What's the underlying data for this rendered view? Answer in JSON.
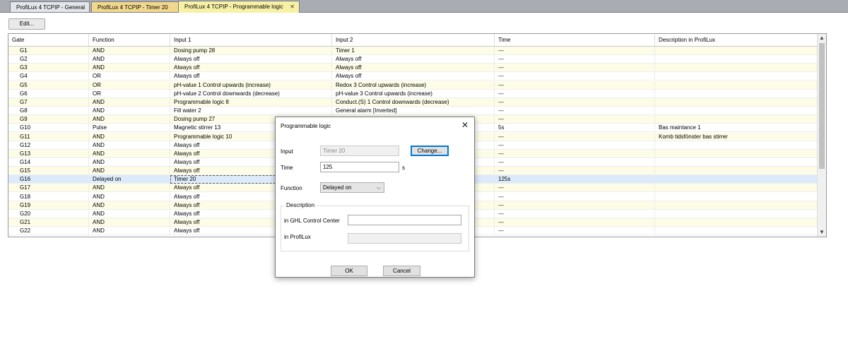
{
  "tabs": [
    {
      "label": "ProfiLux 4 TCPIP - General"
    },
    {
      "label": "ProfiLux 4 TCPIP - Timer 20"
    },
    {
      "label": "ProfiLux 4 TCPIP - Programmable logic",
      "close": "✕"
    }
  ],
  "toolbar": {
    "edit_label": "Edit..."
  },
  "grid": {
    "columns": [
      "Gate",
      "Function",
      "Input 1",
      "Input 2",
      "Time",
      "Description in ProfiLux"
    ],
    "rows": [
      {
        "gate": "G1",
        "function": "AND",
        "input1": "Dosing pump 28",
        "input2": "Timer 1",
        "time": "---",
        "desc": ""
      },
      {
        "gate": "G2",
        "function": "AND",
        "input1": "Always off",
        "input2": "Always off",
        "time": "---",
        "desc": ""
      },
      {
        "gate": "G3",
        "function": "AND",
        "input1": "Always off",
        "input2": "Always off",
        "time": "---",
        "desc": ""
      },
      {
        "gate": "G4",
        "function": "OR",
        "input1": "Always off",
        "input2": "Always off",
        "time": "---",
        "desc": ""
      },
      {
        "gate": "G5",
        "function": "OR",
        "input1": "pH-value 1 Control upwards (increase)",
        "input2": "Redox 3 Control upwards (increase)",
        "time": "---",
        "desc": ""
      },
      {
        "gate": "G6",
        "function": "OR",
        "input1": "pH-value 2 Control downwards (decrease)",
        "input2": "pH-value 3 Control upwards (increase)",
        "time": "---",
        "desc": ""
      },
      {
        "gate": "G7",
        "function": "AND",
        "input1": "Programmable logic 8",
        "input2": "Conduct.(S) 1 Control downwards (decrease)",
        "time": "---",
        "desc": ""
      },
      {
        "gate": "G8",
        "function": "AND",
        "input1": "Fill water 2",
        "input2": "General alarm [Inverted]",
        "time": "---",
        "desc": ""
      },
      {
        "gate": "G9",
        "function": "AND",
        "input1": "Dosing pump 27",
        "input2": "",
        "time": "---",
        "desc": ""
      },
      {
        "gate": "G10",
        "function": "Pulse",
        "input1": "Magnetic stirrer 13",
        "input2": "",
        "time": "5s",
        "desc": "Bas maintance 1"
      },
      {
        "gate": "G11",
        "function": "AND",
        "input1": "Programmable logic 10",
        "input2": "",
        "time": "---",
        "desc": "Komb tidsfönster bas stirrer"
      },
      {
        "gate": "G12",
        "function": "AND",
        "input1": "Always off",
        "input2": "",
        "time": "---",
        "desc": ""
      },
      {
        "gate": "G13",
        "function": "AND",
        "input1": "Always off",
        "input2": "",
        "time": "---",
        "desc": ""
      },
      {
        "gate": "G14",
        "function": "AND",
        "input1": "Always off",
        "input2": "",
        "time": "---",
        "desc": ""
      },
      {
        "gate": "G15",
        "function": "AND",
        "input1": "Always off",
        "input2": "",
        "time": "---",
        "desc": ""
      },
      {
        "gate": "G16",
        "function": "Delayed on",
        "input1": "Timer 20",
        "input2": "",
        "time": "125s",
        "desc": ""
      },
      {
        "gate": "G17",
        "function": "AND",
        "input1": "Always off",
        "input2": "",
        "time": "---",
        "desc": ""
      },
      {
        "gate": "G18",
        "function": "AND",
        "input1": "Always off",
        "input2": "",
        "time": "---",
        "desc": ""
      },
      {
        "gate": "G19",
        "function": "AND",
        "input1": "Always off",
        "input2": "",
        "time": "---",
        "desc": ""
      },
      {
        "gate": "G20",
        "function": "AND",
        "input1": "Always off",
        "input2": "",
        "time": "---",
        "desc": ""
      },
      {
        "gate": "G21",
        "function": "AND",
        "input1": "Always off",
        "input2": "",
        "time": "---",
        "desc": ""
      },
      {
        "gate": "G22",
        "function": "AND",
        "input1": "Always off",
        "input2": "",
        "time": "---",
        "desc": ""
      }
    ],
    "selected_gate": "G16",
    "scroll": {
      "up": "▲",
      "down": "▼"
    }
  },
  "dialog": {
    "title": "Programmable logic",
    "close": "✕",
    "input_label": "Input",
    "input_value": "Timer 20",
    "change_label": "Change...",
    "time_label": "Time",
    "time_value": "125",
    "time_unit": "s",
    "function_label": "Function",
    "function_value": "Delayed on",
    "function_chevron": "⌵",
    "description_legend": "Description",
    "ghl_label": "in GHL Control Center",
    "ghl_value": "",
    "profilux_label": "in ProfiLux",
    "profilux_value": "",
    "ok_label": "OK",
    "cancel_label": "Cancel"
  }
}
